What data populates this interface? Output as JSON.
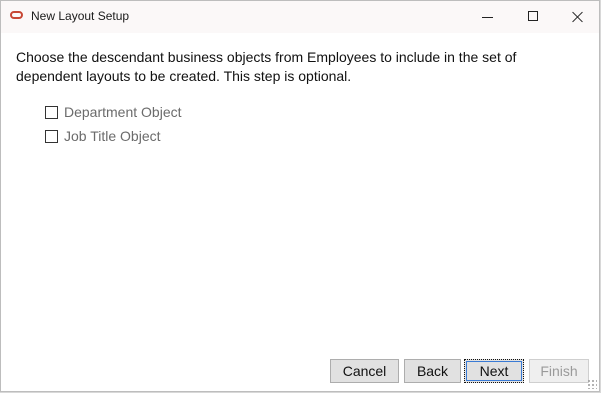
{
  "window": {
    "title": "New Layout Setup",
    "icon": "oracle-logo-icon",
    "controls": [
      "minimize",
      "maximize",
      "close"
    ]
  },
  "content": {
    "instructions": "Choose the descendant business objects from Employees to include in the set of dependent layouts to be created. This step is optional.",
    "options": [
      {
        "label": "Department Object",
        "checked": false
      },
      {
        "label": "Job Title Object",
        "checked": false
      }
    ]
  },
  "buttons": {
    "cancel": "Cancel",
    "back": "Back",
    "next": "Next",
    "finish": "Finish"
  },
  "colors": {
    "brand": "#c74634",
    "titlebar": "#fbf8f8",
    "disabled_text": "#9a9a9a"
  }
}
